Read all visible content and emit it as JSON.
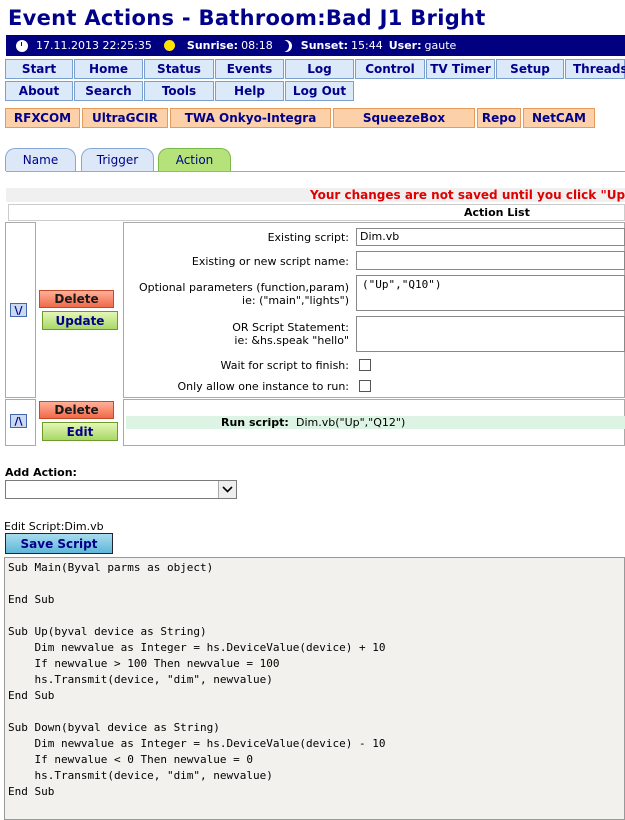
{
  "page": {
    "title": "Event Actions - Bathroom:Bad J1 Bright",
    "datetime": "17.11.2013 22:25:35",
    "sunrise_label": "Sunrise:",
    "sunrise": "08:18",
    "sunset_label": "Sunset:",
    "sunset": "15:44",
    "user_label": "User:",
    "user": "gaute"
  },
  "menu": {
    "row1": [
      "Start",
      "Home",
      "Status",
      "Events",
      "Log",
      "Control",
      "TV Timer",
      "Setup",
      "Threads"
    ],
    "row2": [
      "About",
      "Search",
      "Tools",
      "Help",
      "Log Out"
    ]
  },
  "plugins": [
    "RFXCOM",
    "UltraGCIR",
    "TWA Onkyo-Integra",
    "SqueezeBox",
    "Repo",
    "NetCAM"
  ],
  "tabs": [
    "Name",
    "Trigger",
    "Action"
  ],
  "active_tab": "Action",
  "warning": "Your changes are not saved until you click \"Update\"",
  "action_list_title": "Action List",
  "action1": {
    "arrow": "\\/",
    "delete_label": "Delete",
    "update_label": "Update",
    "existing_script_label": "Existing script:",
    "existing_script_value": "Dim.vb",
    "script_name_label": "Existing or new script name:",
    "script_name_value": "",
    "params_label": "Optional parameters (function,param)",
    "params_hint": "ie: (\"main\",\"lights\")",
    "params_value": "(\"Up\",\"Q10\")",
    "statement_label": "OR Script Statement:",
    "statement_hint": "ie: &hs.speak \"hello\"",
    "statement_value": "",
    "wait_label": "Wait for script to finish:",
    "wait_checked": false,
    "one_instance_label": "Only allow one instance to run:",
    "one_instance_checked": false
  },
  "action2": {
    "arrow": "/\\",
    "delete_label": "Delete",
    "edit_label": "Edit",
    "run_label": "Run script:",
    "run_value": "Dim.vb(\"Up\",\"Q12\")"
  },
  "add_action": {
    "label": "Add Action:",
    "selected": ""
  },
  "editor": {
    "label": "Edit Script:Dim.vb",
    "save_label": "Save Script",
    "code": "Sub Main(Byval parms as object)\n\nEnd Sub\n\nSub Up(byval device as String)\n    Dim newvalue as Integer = hs.DeviceValue(device) + 10\n    If newvalue > 100 Then newvalue = 100\n    hs.Transmit(device, \"dim\", newvalue)\nEnd Sub\n\nSub Down(byval device as String)\n    Dim newvalue as Integer = hs.DeviceValue(device) - 10\n    If newvalue < 0 Then newvalue = 0\n    hs.Transmit(device, \"dim\", newvalue)\nEnd Sub"
  },
  "icons": {
    "clock": "clock-icon",
    "sun": "sun-icon",
    "moon": "moon-icon",
    "dropdown": "chevron-down-icon"
  },
  "colors": {
    "title": "#00008b",
    "infobar": "#000080",
    "warning": "#e00000",
    "active_tab": "#b5e37a",
    "delete_button": "#f06a48",
    "ok_button": "#a8d868",
    "plugin_button": "#fcd0a8"
  }
}
